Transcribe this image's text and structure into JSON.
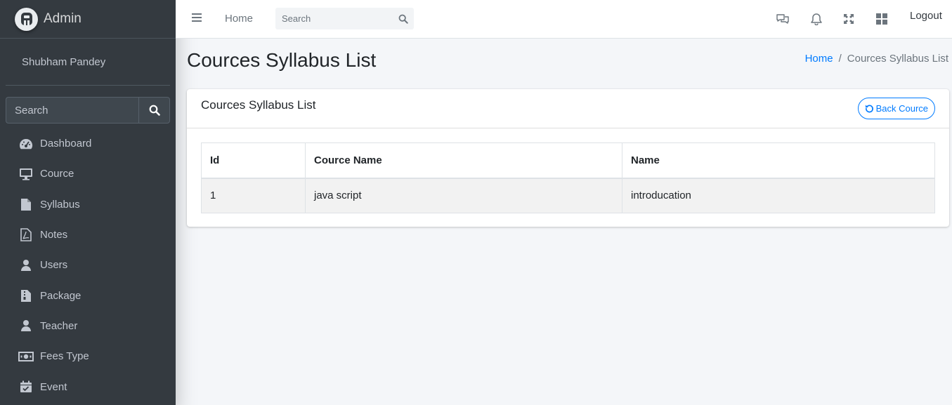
{
  "brand": {
    "name": "Admin",
    "logo_letter": "A"
  },
  "user": {
    "name": "Shubham Pandey"
  },
  "sidebar": {
    "search_placeholder": "Search",
    "items": [
      {
        "label": "Dashboard",
        "icon": "tachometer-icon"
      },
      {
        "label": "Cource",
        "icon": "desktop-icon"
      },
      {
        "label": "Syllabus",
        "icon": "file-icon"
      },
      {
        "label": "Notes",
        "icon": "file-pdf-icon"
      },
      {
        "label": "Users",
        "icon": "user-icon"
      },
      {
        "label": "Package",
        "icon": "file-archive-icon"
      },
      {
        "label": "Teacher",
        "icon": "user-icon"
      },
      {
        "label": "Fees Type",
        "icon": "money-bill-icon"
      },
      {
        "label": "Event",
        "icon": "calendar-check-icon"
      }
    ]
  },
  "navbar": {
    "home_label": "Home",
    "search_placeholder": "Search",
    "logout_label": "Logout"
  },
  "page": {
    "title": "Cources Syllabus List",
    "breadcrumb": {
      "home": "Home",
      "separator": "/",
      "active": "Cources Syllabus List"
    }
  },
  "card": {
    "title": "Cources Syllabus List",
    "back_button": "Back Cource"
  },
  "table": {
    "headers": [
      "Id",
      "Cource Name",
      "Name"
    ],
    "rows": [
      [
        "1",
        "java script",
        "introducation"
      ]
    ]
  },
  "colors": {
    "sidebar_bg": "#343a40",
    "accent": "#007bff",
    "content_bg": "#f4f6f9"
  }
}
